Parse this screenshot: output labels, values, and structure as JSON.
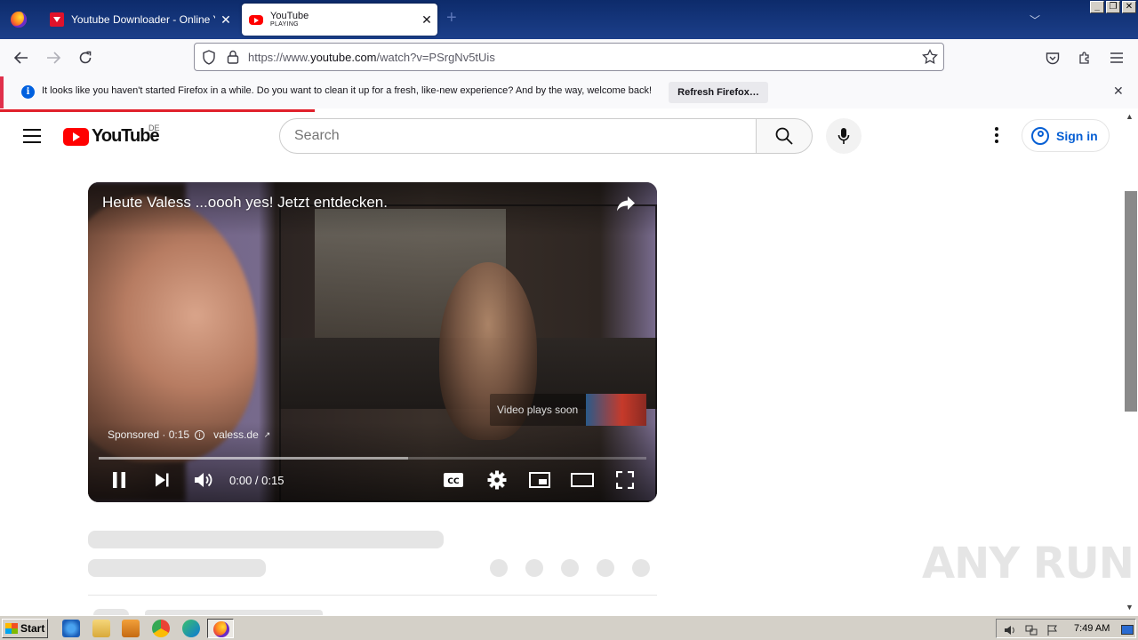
{
  "browser": {
    "tabs": [
      {
        "title": "Youtube Downloader - Online Youtu",
        "active": false
      },
      {
        "title": "YouTube",
        "subtitle": "PLAYING",
        "active": true
      }
    ],
    "new_tab": "+",
    "url_prefix": "https://www.",
    "url_domain": "youtube.com",
    "url_path": "/watch?v=PSrgNv5tUis",
    "notification": {
      "text": "It looks like you haven't started Firefox in a while. Do you want to clean it up for a fresh, like-new experience? And by the way, welcome back!",
      "button": "Refresh Firefox…"
    },
    "load_progress": 0.28
  },
  "youtube": {
    "logo_text": "YouTube",
    "country": "DE",
    "search_placeholder": "Search",
    "sign_in": "Sign in",
    "player": {
      "ad_title": "Heute Valess ...oooh yes! Jetzt entdecken.",
      "plays_soon": "Video plays soon",
      "sponsored": "Sponsored · 0:15",
      "advertiser": "valess.de",
      "time": "0:00 / 0:15",
      "played_fraction": 0.0,
      "buffered_fraction": 0.565
    }
  },
  "watermark": "ANY RUN",
  "taskbar": {
    "start": "Start",
    "clock": "7:49 AM"
  },
  "colors": {
    "yt_red": "#ff0000",
    "link_blue": "#065fd4",
    "firefox_alert": "#e0304b",
    "ad_progress": "#ffcc00"
  }
}
